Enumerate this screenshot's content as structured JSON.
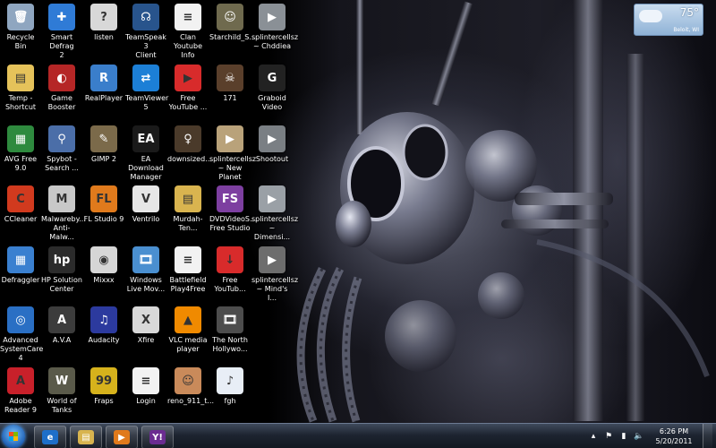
{
  "desktop": {
    "icons": [
      {
        "label": "Recycle Bin",
        "icon": "recycle-bin-icon",
        "glyph": "🗑",
        "color": "#8fa6c0"
      },
      {
        "label": "Smart Defrag\n2",
        "icon": "smart-defrag-icon",
        "glyph": "✚",
        "color": "#2f7bd6"
      },
      {
        "label": "listen",
        "icon": "listen-shortcut-icon",
        "glyph": "?",
        "color": "#d8d8d8"
      },
      {
        "label": "TeamSpeak 3\nClient",
        "icon": "teamspeak-icon",
        "glyph": "☊",
        "color": "#28548c"
      },
      {
        "label": "Clan\nYoutube Info",
        "icon": "text-document-icon",
        "glyph": "≡",
        "color": "#f2f2f2"
      },
      {
        "label": "Starchild_S...",
        "icon": "image-file-icon",
        "glyph": "☺",
        "color": "#6f6a4e"
      },
      {
        "label": "splintercellsz\n~ Chddiea",
        "icon": "video-file-icon",
        "glyph": "▶",
        "color": "#8a9096"
      },
      {
        "label": "Temp -\nShortcut",
        "icon": "folder-icon",
        "glyph": "▤",
        "color": "#e5c25a"
      },
      {
        "label": "Game\nBooster",
        "icon": "game-booster-icon",
        "glyph": "◐",
        "color": "#b52626"
      },
      {
        "label": "RealPlayer",
        "icon": "realplayer-icon",
        "glyph": "R",
        "color": "#3a7ecb"
      },
      {
        "label": "TeamViewer\n5",
        "icon": "teamviewer-icon",
        "glyph": "⇄",
        "color": "#1c7fd6"
      },
      {
        "label": "Free\nYouTube ...",
        "icon": "free-youtube-icon",
        "glyph": "▶",
        "color": "#d82b2b"
      },
      {
        "label": "171",
        "icon": "image-file-icon",
        "glyph": "☠",
        "color": "#5a3f2b"
      },
      {
        "label": "Graboid\nVideo",
        "icon": "graboid-icon",
        "glyph": "G",
        "color": "#222222"
      },
      {
        "label": "AVG Free 9.0",
        "icon": "avg-icon",
        "glyph": "▦",
        "color": "#2e8a3e"
      },
      {
        "label": "Spybot -\nSearch ...",
        "icon": "spybot-icon",
        "glyph": "⚲",
        "color": "#4b6ea8"
      },
      {
        "label": "GIMP 2",
        "icon": "gimp-icon",
        "glyph": "✎",
        "color": "#7b6a4a"
      },
      {
        "label": "EA Download\nManager",
        "icon": "ea-icon",
        "glyph": "EA",
        "color": "#1a1a1a"
      },
      {
        "label": "downsized...",
        "icon": "image-file-icon",
        "glyph": "♀",
        "color": "#4a3a2a"
      },
      {
        "label": "splintercellsz\n~ New\nPlanet",
        "icon": "video-file-icon",
        "glyph": "▶",
        "color": "#b9a27a"
      },
      {
        "label": "Shootout",
        "icon": "video-file-icon",
        "glyph": "▶",
        "color": "#7a7f84"
      },
      {
        "label": "CCleaner",
        "icon": "ccleaner-icon",
        "glyph": "C",
        "color": "#d13a1e"
      },
      {
        "label": "Malwareby...\nAnti-Malw...",
        "icon": "malwarebytes-icon",
        "glyph": "M",
        "color": "#c8c8c8"
      },
      {
        "label": "FL Studio 9",
        "icon": "fl-studio-icon",
        "glyph": "FL",
        "color": "#e07a1c"
      },
      {
        "label": "Ventrilo",
        "icon": "ventrilo-icon",
        "glyph": "V",
        "color": "#e6e6e6"
      },
      {
        "label": "Murdah-Ten...",
        "icon": "folder-icon",
        "glyph": "▤",
        "color": "#d9b44f"
      },
      {
        "label": "DVDVideoS...\nFree Studio",
        "icon": "free-studio-icon",
        "glyph": "FS",
        "color": "#7d3fa0"
      },
      {
        "label": "splintercellsz\n~ Dimensi...",
        "icon": "video-file-icon",
        "glyph": "▶",
        "color": "#9aa0a6"
      },
      {
        "label": "Defraggler",
        "icon": "defraggler-icon",
        "glyph": "▦",
        "color": "#3a80d0"
      },
      {
        "label": "HP Solution\nCenter",
        "icon": "hp-icon",
        "glyph": "hp",
        "color": "#2b2b2b"
      },
      {
        "label": "Mixxx",
        "icon": "mixxx-icon",
        "glyph": "◉",
        "color": "#d6d6d6"
      },
      {
        "label": "Windows\nLive Mov...",
        "icon": "windows-live-movie-icon",
        "glyph": "🎞",
        "color": "#4a8fd0"
      },
      {
        "label": "Battlefield\nPlay4Free",
        "icon": "text-document-icon",
        "glyph": "≡",
        "color": "#f2f2f2"
      },
      {
        "label": "Free\nYouTub...",
        "icon": "free-youtube-download-icon",
        "glyph": "↓",
        "color": "#d82b2b"
      },
      {
        "label": "splintercellsz\n~ Mind's I...",
        "icon": "video-file-icon",
        "glyph": "▶",
        "color": "#6d6d6d"
      },
      {
        "label": "Advanced\nSystemCare 4",
        "icon": "advanced-systemcare-icon",
        "glyph": "◎",
        "color": "#2a6fc4"
      },
      {
        "label": "A.V.A",
        "icon": "ava-icon",
        "glyph": "A",
        "color": "#3c3c3c"
      },
      {
        "label": "Audacity",
        "icon": "audacity-icon",
        "glyph": "♫",
        "color": "#2c3a9e"
      },
      {
        "label": "Xfire",
        "icon": "xfire-icon",
        "glyph": "X",
        "color": "#d8d8d8"
      },
      {
        "label": "VLC media\nplayer",
        "icon": "vlc-icon",
        "glyph": "▲",
        "color": "#f08a00"
      },
      {
        "label": "The North\nHollywo...",
        "icon": "video-file-icon",
        "glyph": "🎞",
        "color": "#4d4d4d"
      },
      {
        "label": "Adobe\nReader 9",
        "icon": "adobe-reader-icon",
        "glyph": "A",
        "color": "#c8202a"
      },
      {
        "label": "World of\nTanks",
        "icon": "world-of-tanks-icon",
        "glyph": "W",
        "color": "#5a5a4a"
      },
      {
        "label": "Fraps",
        "icon": "fraps-icon",
        "glyph": "99",
        "color": "#d6b21c"
      },
      {
        "label": "Login",
        "icon": "text-document-icon",
        "glyph": "≡",
        "color": "#f2f2f2"
      },
      {
        "label": "reno_911_t...",
        "icon": "image-file-icon",
        "glyph": "☺",
        "color": "#c98a5a"
      },
      {
        "label": "fgh",
        "icon": "mp3-file-icon",
        "glyph": "♪",
        "color": "#e8eef6"
      }
    ]
  },
  "weather": {
    "temperature": "75°",
    "city": "Beloit, WI",
    "icon": "partly-cloudy-icon"
  },
  "taskbar": {
    "start_icon": "windows-start-icon",
    "pinned": [
      {
        "name": "internet-explorer",
        "icon": "internet-explorer-icon",
        "glyph": "e",
        "color": "#1e6fc9"
      },
      {
        "name": "windows-explorer",
        "icon": "folder-icon",
        "glyph": "▤",
        "color": "#d8b44f"
      },
      {
        "name": "media-player",
        "icon": "media-player-icon",
        "glyph": "▶",
        "color": "#e07a1c"
      },
      {
        "name": "yahoo-messenger",
        "icon": "yahoo-messenger-icon",
        "glyph": "Y!",
        "color": "#6b2c91"
      }
    ],
    "tray": {
      "icons": [
        {
          "name": "show-hidden-icons",
          "icon": "chevron-up-icon",
          "glyph": "▴"
        },
        {
          "name": "action-center",
          "icon": "flag-icon",
          "glyph": "⚑"
        },
        {
          "name": "network",
          "icon": "network-icon",
          "glyph": "▮"
        },
        {
          "name": "volume",
          "icon": "speaker-icon",
          "glyph": "🔈"
        }
      ],
      "time": "6:26 PM",
      "date": "5/20/2011"
    }
  }
}
